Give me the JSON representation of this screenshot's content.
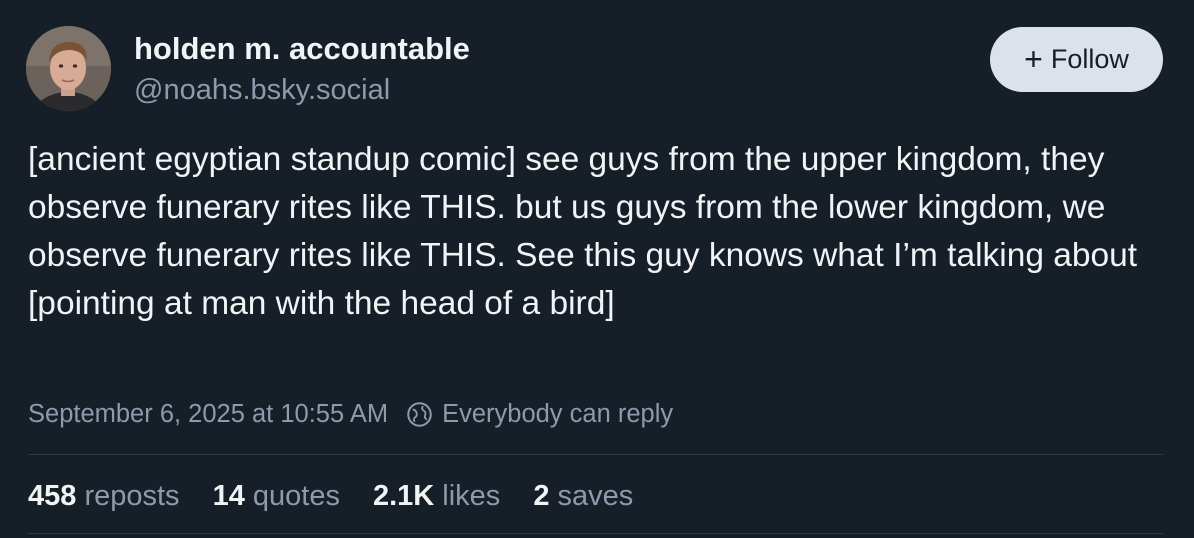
{
  "author": {
    "display_name": "holden m. accountable",
    "handle": "@noahs.bsky.social",
    "avatar_icon": "profile-photo"
  },
  "follow_button": {
    "icon": "plus-icon",
    "plus_glyph": "+",
    "label": "Follow"
  },
  "post": {
    "text": "[ancient egyptian standup comic] see guys from the upper kingdom, they observe funerary rites like THIS. but us guys from the lower kingdom, we observe funerary rites like THIS. See this guy knows what I’m talking about [pointing at man with the head of a bird]",
    "timestamp": "September 6, 2025 at 10:55 AM",
    "reply_icon": "globe-icon",
    "reply_setting": "Everybody can reply"
  },
  "stats": [
    {
      "count": "458",
      "label": "reposts"
    },
    {
      "count": "14",
      "label": "quotes"
    },
    {
      "count": "2.1K",
      "label": "likes"
    },
    {
      "count": "2",
      "label": "saves"
    }
  ],
  "colors": {
    "background": "#161e27",
    "text_primary": "#f1f3f5",
    "text_secondary": "#8d9aab",
    "button_bg": "#dce2ea",
    "divider": "#2e3947"
  }
}
